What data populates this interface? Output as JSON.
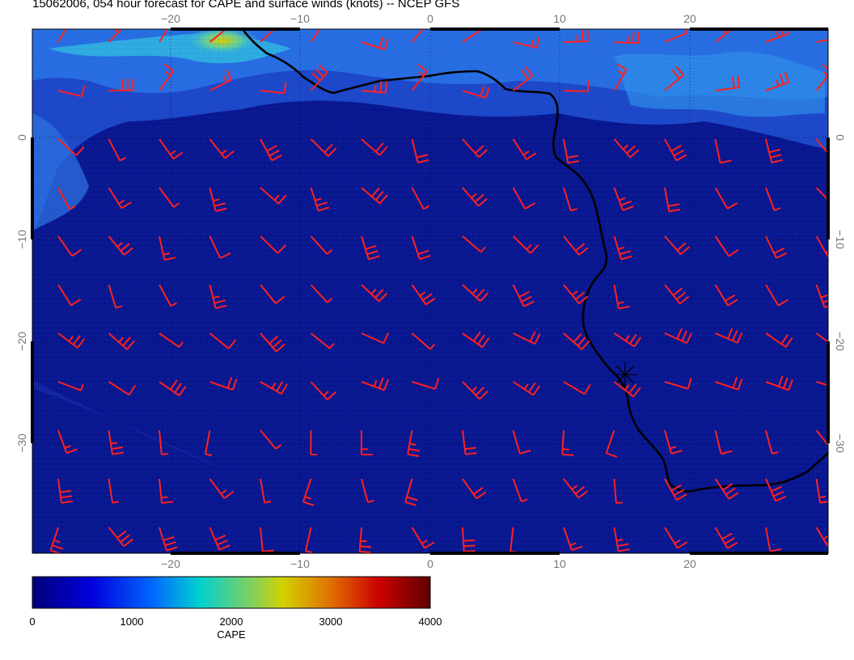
{
  "title": "15062006, 054 hour forecast for CAPE and surface winds (knots) -- NCEP GFS",
  "axes": {
    "lon_labels": [
      "−20",
      "−10",
      "0",
      "10",
      "20"
    ],
    "lat_labels": [
      "0",
      "−10",
      "−20",
      "−30"
    ]
  },
  "colorbar": {
    "label": "CAPE",
    "ticks": [
      "0",
      "1000",
      "2000",
      "3000",
      "4000"
    ],
    "range": [
      0,
      4000
    ],
    "colors": [
      "#00007f",
      "#0000ff",
      "#00bfff",
      "#40e0d0",
      "#c8d200",
      "#e08000",
      "#cc0000",
      "#700000"
    ]
  },
  "colors": {
    "ocean_field": "#0a1a9a",
    "high_cape_band": "#3cc8e0",
    "wind_barbs": "#ff2020",
    "coastline": "#000000"
  }
}
